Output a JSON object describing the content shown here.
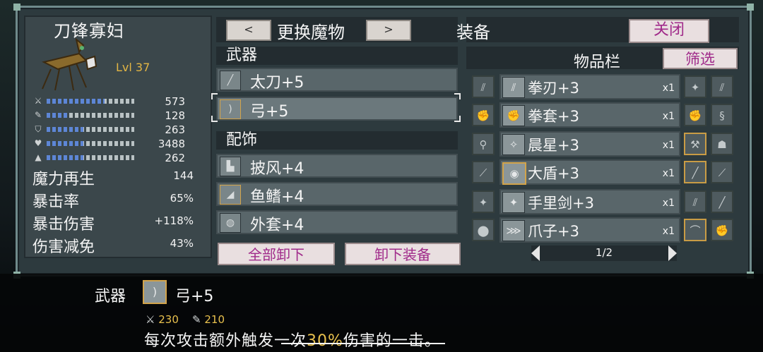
{
  "monster": {
    "name": "刀锋寡妇",
    "level": "Lvl 37"
  },
  "stats": [
    {
      "icon": "attack-icon",
      "glyph": "⚔",
      "value": "573",
      "fill": 0.66
    },
    {
      "icon": "magic-icon",
      "glyph": "✎",
      "value": "128",
      "fill": 0.25
    },
    {
      "icon": "defense-icon",
      "glyph": "⛉",
      "value": "263",
      "fill": 0.42
    },
    {
      "icon": "health-icon",
      "glyph": "♥",
      "value": "3488",
      "fill": 0.42
    },
    {
      "icon": "resist-icon",
      "glyph": "▲",
      "value": "262",
      "fill": 0.42
    }
  ],
  "extra_stats": [
    {
      "label": "魔力再生",
      "value": "144"
    },
    {
      "label": "暴击率",
      "value": "65%"
    },
    {
      "label": "暴击伤害",
      "value": "+118%"
    },
    {
      "label": "伤害减免",
      "value": "43%"
    }
  ],
  "header": {
    "prev": "<",
    "next": ">",
    "change_monster": "更换魔物",
    "equipment_title": "装备",
    "close": "关闭"
  },
  "weapons": {
    "title": "武器",
    "slots": [
      {
        "icon": "sword-icon",
        "glyph": "╱",
        "label": "太刀+5"
      },
      {
        "icon": "bow-icon",
        "glyph": ")",
        "label": "弓+5"
      }
    ]
  },
  "accessories": {
    "title": "配饰",
    "slots": [
      {
        "icon": "cape-icon",
        "glyph": "▙",
        "label": "披风+4"
      },
      {
        "icon": "fin-icon",
        "glyph": "◢",
        "label": "鱼鳍+4"
      },
      {
        "icon": "coat-icon",
        "glyph": "◍",
        "label": "外套+4"
      }
    ]
  },
  "actions": {
    "unequip_all": "全部卸下",
    "unequip": "卸下装备"
  },
  "inventory": {
    "title": "物品栏",
    "filter": "筛选",
    "rows": [
      {
        "icon": "knuckle-blade-icon",
        "glyph": "⫽",
        "name": "拳刃+3",
        "qty": "x1"
      },
      {
        "icon": "gauntlet-icon",
        "glyph": "✊",
        "name": "拳套+3",
        "qty": "x1"
      },
      {
        "icon": "morning-star-icon",
        "glyph": "✧",
        "name": "晨星+3",
        "qty": "x1"
      },
      {
        "icon": "shield-icon",
        "glyph": "◉",
        "name": "大盾+3",
        "qty": "x1"
      },
      {
        "icon": "shuriken-icon",
        "glyph": "✦",
        "name": "手里剑+3",
        "qty": "x1"
      },
      {
        "icon": "claw-icon",
        "glyph": "⋙",
        "name": "爪子+3",
        "qty": "x1"
      }
    ],
    "left_icons": [
      "glove-icon",
      "gauntlet-icon",
      "mace-icon",
      "staff-icon",
      "shuriken-icon",
      "helmet-icon"
    ],
    "left_glyphs": [
      "⫽",
      "✊",
      "⚲",
      "⟋",
      "✦",
      "⬤"
    ],
    "right_icons_a": [
      "shuriken-icon",
      "gauntlet-icon",
      "hammer-icon",
      "sword-icon",
      "glove-icon",
      "scythe-icon"
    ],
    "right_glyphs_a": [
      "✦",
      "✊",
      "⚒",
      "╱",
      "⫽",
      "⌒"
    ],
    "right_icons_b": [
      "glove-icon",
      "whip-icon",
      "skull-icon",
      "staff-icon",
      "wand-icon",
      "fist-icon"
    ],
    "right_glyphs_b": [
      "⫽",
      "§",
      "☗",
      "⟋",
      "╱",
      "✊"
    ],
    "page": "1/2"
  },
  "tooltip": {
    "slot_label": "武器",
    "item_name": "弓+5",
    "stat_attack": "230",
    "stat_magic": "210",
    "desc_pre": "每次攻击额外触发一次",
    "desc_highlight": "30%",
    "desc_post": "伤害的一击。"
  },
  "colors": {
    "accent_pink": "#a02a8a",
    "level_gold": "#e2b544",
    "bar_blue": "#5d86d6"
  }
}
